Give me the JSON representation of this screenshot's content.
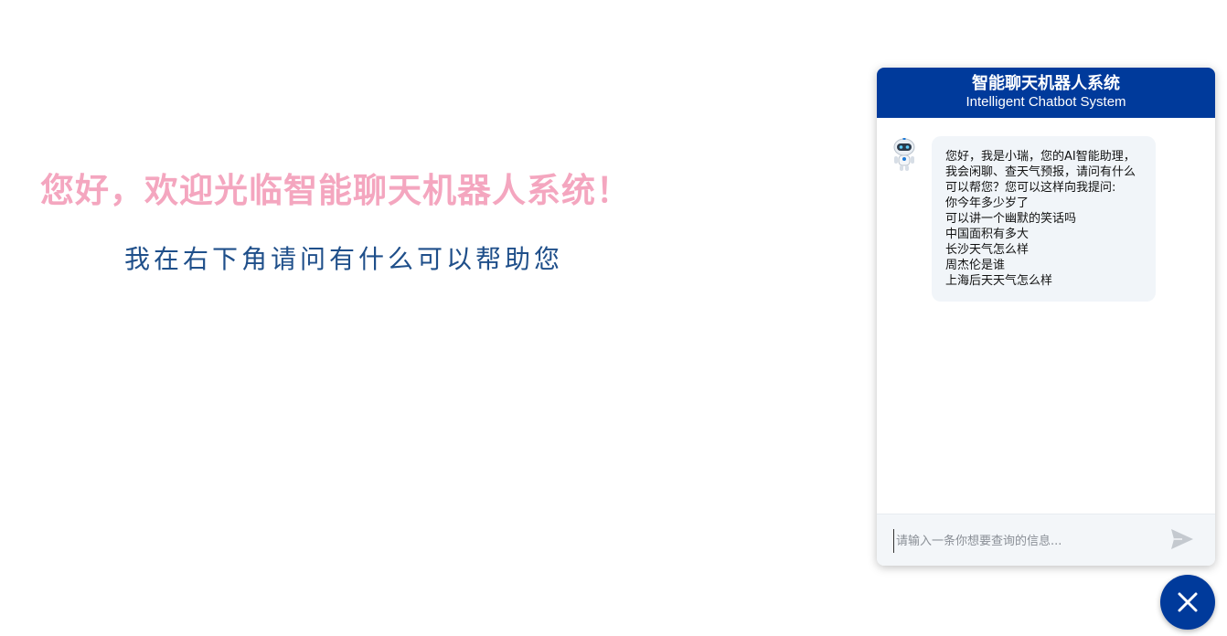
{
  "welcome": {
    "title": "您好，欢迎光临智能聊天机器人系统！",
    "subtitle": "我在右下角请问有什么可以帮助您"
  },
  "chat": {
    "header_cn": "智能聊天机器人系统",
    "header_en": "Intelligent Chatbot System",
    "bot_message": {
      "intro": "您好，我是小瑞，您的AI智能助理，我会闲聊、查天气预报，请问有什么可以帮您？您可以这样向我提问:",
      "examples": [
        "你今年多少岁了",
        "可以讲一个幽默的笑话吗",
        "中国面积有多大",
        "长沙天气怎么样",
        "周杰伦是谁",
        "上海后天天气怎么样"
      ]
    },
    "input_placeholder": "请输入一条你想要查询的信息...",
    "input_value": ""
  },
  "icons": {
    "bot_avatar": "robot-icon",
    "send": "send-icon",
    "close": "close-icon"
  },
  "colors": {
    "header_bg": "#003a9b",
    "title_pink": "#f4a6bf",
    "subtitle_blue": "#1f4f8a",
    "bubble_bg": "#f1f5f9"
  }
}
